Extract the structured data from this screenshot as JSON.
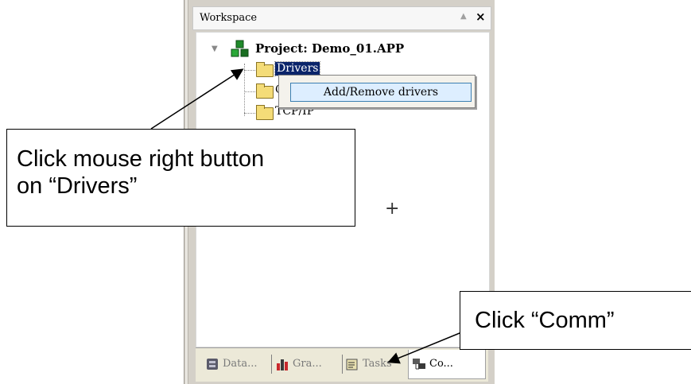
{
  "workspace": {
    "title": "Workspace",
    "pin_icon": "triangle-up-icon",
    "close_icon": "close-icon"
  },
  "tree": {
    "root": {
      "label": "Project: Demo_01.APP",
      "icon": "project-cubes-icon"
    },
    "children": [
      {
        "label": "Drivers",
        "icon": "folder-icon",
        "selected": true
      },
      {
        "label": "C",
        "icon": "folder-icon"
      },
      {
        "label": "TCP/IP",
        "icon": "folder-icon"
      }
    ]
  },
  "context_menu": {
    "items": [
      {
        "label": "Add/Remove drivers"
      }
    ]
  },
  "tabs": [
    {
      "label": "Data...",
      "icon": "database-icon",
      "active": false
    },
    {
      "label": "Gra...",
      "icon": "graphics-icon",
      "active": false
    },
    {
      "label": "Tasks",
      "icon": "tasks-icon",
      "active": false
    },
    {
      "label": "Co...",
      "icon": "comm-icon",
      "active": true
    }
  ],
  "annotations": {
    "callout_drivers_line1": "Click mouse right button",
    "callout_drivers_line2": "on “Drivers”",
    "callout_comm": "Click “Comm”"
  },
  "colors": {
    "selection": "#0a246a",
    "menu_highlight": "#ddeeff",
    "menu_highlight_border": "#3c7fb1",
    "folder": "#f4dc78"
  }
}
